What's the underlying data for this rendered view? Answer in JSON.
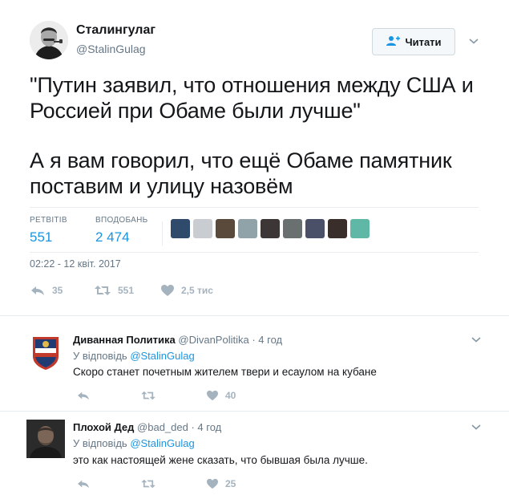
{
  "tweet": {
    "display_name": "Сталингулаг",
    "handle": "@StalinGulag",
    "follow_label": "Читати",
    "text_paragraph_1": "\"Путин заявил, что отношения между США и Россией при Обаме были лучше\"",
    "text_paragraph_2": "А я вам говорил, что ещё Обаме памятник поставим и улицу назовём",
    "retweets_label": "РЕТВІТІВ",
    "retweets_value": "551",
    "likes_label": "ВПОДОБАНЬ",
    "likes_value": "2 474",
    "timestamp": "02:22 - 12 квіт. 2017",
    "actions": {
      "reply_count": "35",
      "retweet_count": "551",
      "like_count": "2,5 тис"
    },
    "liker_colors": [
      "#2f4a6b",
      "#c9cdd2",
      "#5a4a3c",
      "#8fa3a8",
      "#3d3636",
      "#6a7070",
      "#4a5068",
      "#3a2e2a",
      "#5fb8a5"
    ]
  },
  "replies": [
    {
      "display_name": "Диванная Политика",
      "handle": "@DivanPolitika",
      "time": "· 4 год",
      "reply_prefix": "У відповідь",
      "reply_to": "@StalinGulag",
      "text": "Скоро станет почетным жителем твери и есаулом на кубане",
      "like_count": "40"
    },
    {
      "display_name": "Плохой Дед",
      "handle": "@bad_ded",
      "time": "· 4 год",
      "reply_prefix": "У відповідь",
      "reply_to": "@StalinGulag",
      "text": "это как настоящей жене сказать, что бывшая была лучше.",
      "like_count": "25"
    }
  ],
  "colors": {
    "link": "#1b95e0",
    "muted": "#657786",
    "icon": "#a5b3bf",
    "border": "#e6ecf0"
  }
}
